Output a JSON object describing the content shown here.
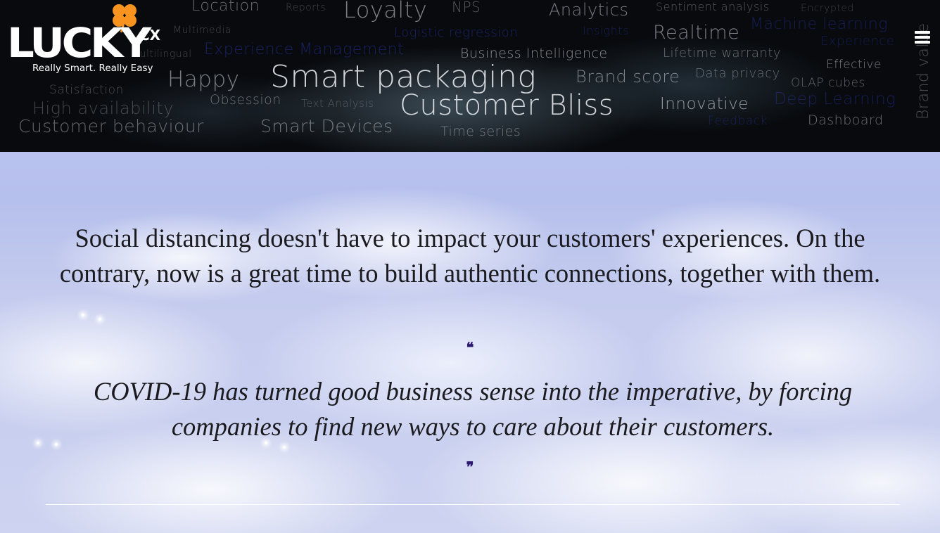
{
  "brand": {
    "logo_word": "LUCKY",
    "logo_suffix": "CX",
    "tagline": "Really Smart. Really Easy",
    "accent": "#f7931e"
  },
  "header": {
    "menu_icon": "hamburger-menu-icon",
    "word_cloud": [
      "Location",
      "Reports",
      "Loyalty",
      "NPS",
      "Analytics",
      "Sentiment analysis",
      "Encrypted",
      "Multimedia",
      "Logistic regression",
      "Insights",
      "Realtime",
      "Machine learning",
      "Experience Management",
      "Multilingual",
      "Business Intelligence",
      "Lifetime warranty",
      "Experience",
      "Effective",
      "Happy",
      "Smart packaging",
      "Brand score",
      "Data privacy",
      "Brand value",
      "Satisfaction",
      "Obsession",
      "Text Analysis",
      "Customer Bliss",
      "Innovative",
      "OLAP cubes",
      "Deep Learning",
      "High availability",
      "Customer behaviour",
      "Smart Devices",
      "Time series",
      "Feedback",
      "Dashboard"
    ]
  },
  "main": {
    "lead": "Social distancing doesn't have to impact your customers' experiences. On the contrary, now is a great time to build authentic connections, together with them.",
    "open_quote": "❝",
    "quote": "COVID-19 has turned good business sense into the imperative, by forcing companies to find new ways to care about their customers.",
    "close_quote": "❞",
    "quote_mark_color": "#2c1970"
  }
}
